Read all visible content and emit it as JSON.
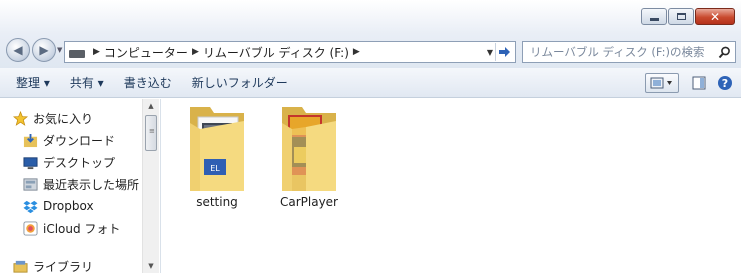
{
  "window": {
    "buttons": {
      "minimize": "minimize",
      "maximize": "maximize",
      "close": "close"
    }
  },
  "address": {
    "breadcrumbs": [
      "コンピューター",
      "リムーバブル ディスク (F:)"
    ],
    "search_placeholder": "リムーバブル ディスク (F:)の検索"
  },
  "toolbar": {
    "organize": "整理 ▾",
    "share": "共有 ▾",
    "burn": "書き込む",
    "new_folder": "新しいフォルダー"
  },
  "nav": {
    "favorites": "お気に入り",
    "downloads": "ダウンロード",
    "desktop": "デスクトップ",
    "recent": "最近表示した場所",
    "dropbox": "Dropbox",
    "icloud": "iCloud フォト",
    "libraries": "ライブラリ"
  },
  "files": [
    {
      "name": "setting"
    },
    {
      "name": "CarPlayer"
    }
  ],
  "colors": {
    "accent": "#2e63b7",
    "folder": "#f0d070",
    "close": "#c94a2f"
  }
}
